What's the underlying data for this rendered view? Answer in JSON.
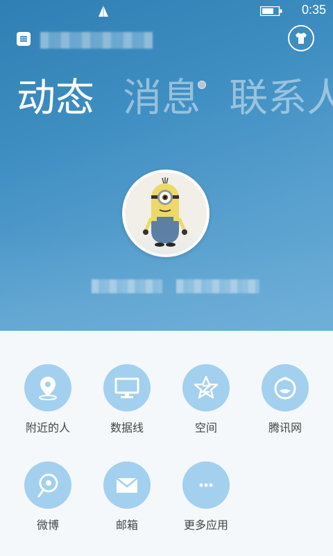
{
  "status_bar": {
    "time": "0:35"
  },
  "tabs": [
    {
      "label": "动态",
      "active": true
    },
    {
      "label": "消息",
      "active": false,
      "has_dot": true
    },
    {
      "label": "联系人",
      "active": false
    }
  ],
  "apps": [
    {
      "label": "附近的人",
      "icon": "location-pin-icon"
    },
    {
      "label": "数据线",
      "icon": "monitor-icon"
    },
    {
      "label": "空间",
      "icon": "qzone-star-icon"
    },
    {
      "label": "腾讯网",
      "icon": "tencent-news-icon"
    },
    {
      "label": "微博",
      "icon": "weibo-icon"
    },
    {
      "label": "邮箱",
      "icon": "mail-icon"
    },
    {
      "label": "更多应用",
      "icon": "more-icon"
    }
  ],
  "colors": {
    "hero_blue": "#3f8ec2",
    "app_circle": "#a3d0ee",
    "label_text": "#444444"
  }
}
